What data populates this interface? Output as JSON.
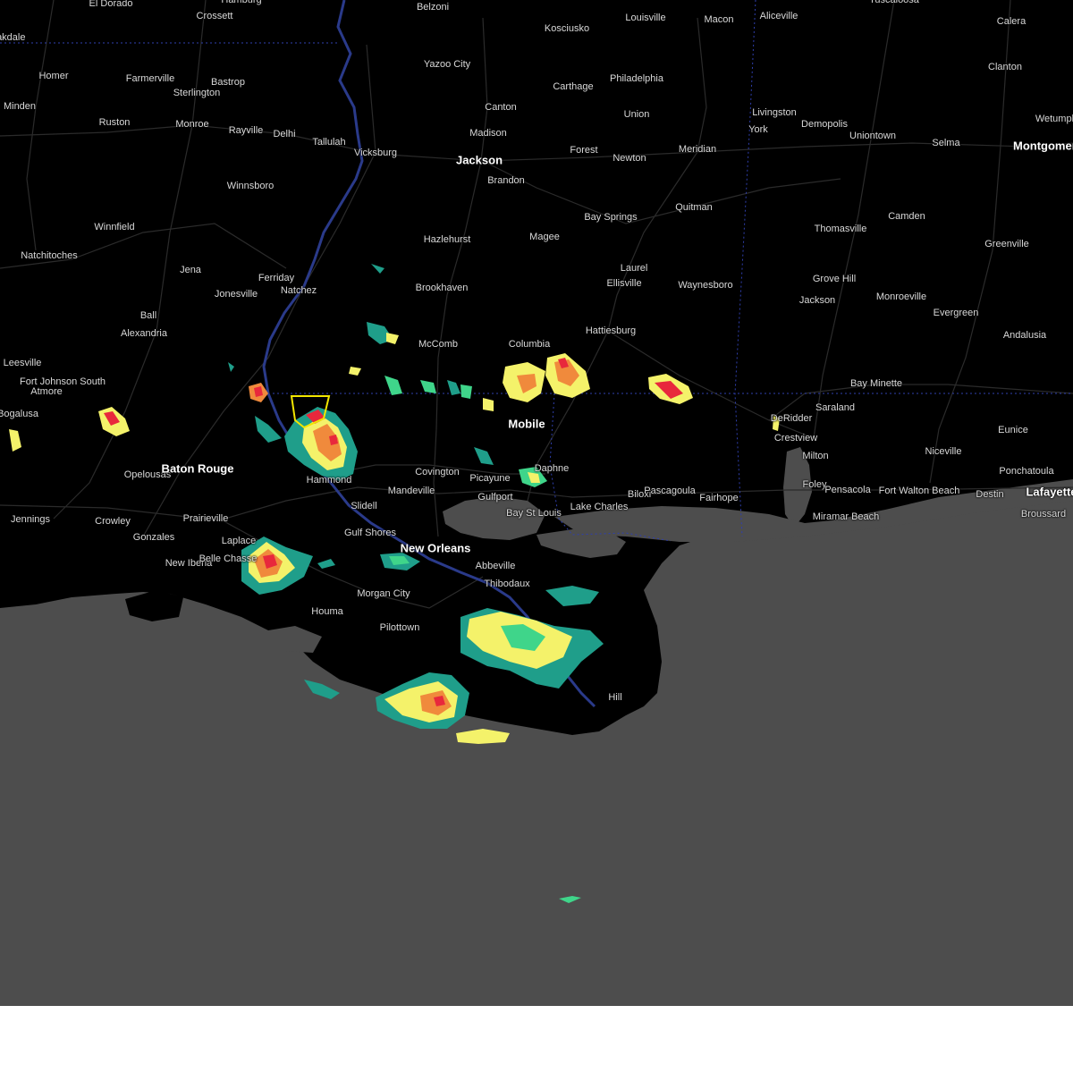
{
  "map": {
    "colors": {
      "land": "#000000",
      "water": "#4d4d4d",
      "roads": "#2b2b2b",
      "river": "#2a3a8a",
      "state_border": "#2f3fae",
      "warning_polygon": "#f2e600",
      "radar_light": "#1f9e8a",
      "radar_mid": "#3fd58a",
      "radar_yellow": "#f4f26a",
      "radar_orange": "#f08a3c",
      "radar_red": "#e8283c"
    },
    "cities": [
      {
        "name": "El Dorado",
        "big": false
      },
      {
        "name": "Crossett",
        "big": false
      },
      {
        "name": "Hamburg",
        "big": false
      },
      {
        "name": "Belzoni",
        "big": false
      },
      {
        "name": "Kosciusko",
        "big": false
      },
      {
        "name": "Louisville",
        "big": false
      },
      {
        "name": "Macon",
        "big": false
      },
      {
        "name": "Aliceville",
        "big": false
      },
      {
        "name": "Tuscaloosa",
        "big": false
      },
      {
        "name": "Calera",
        "big": false
      },
      {
        "name": "Homer",
        "big": false
      },
      {
        "name": "Farmerville",
        "big": false
      },
      {
        "name": "Bastrop",
        "big": false
      },
      {
        "name": "Sterlington",
        "big": false
      },
      {
        "name": "Yazoo City",
        "big": false
      },
      {
        "name": "Carthage",
        "big": false
      },
      {
        "name": "Philadelphia",
        "big": false
      },
      {
        "name": "Clanton",
        "big": false
      },
      {
        "name": "Minden",
        "big": false
      },
      {
        "name": "Ruston",
        "big": false
      },
      {
        "name": "Monroe",
        "big": false
      },
      {
        "name": "Rayville",
        "big": false
      },
      {
        "name": "Delhi",
        "big": false
      },
      {
        "name": "Tallulah",
        "big": false
      },
      {
        "name": "Canton",
        "big": false
      },
      {
        "name": "Madison",
        "big": false
      },
      {
        "name": "Union",
        "big": false
      },
      {
        "name": "Livingston",
        "big": false
      },
      {
        "name": "York",
        "big": false
      },
      {
        "name": "Demopolis",
        "big": false
      },
      {
        "name": "Uniontown",
        "big": false
      },
      {
        "name": "Selma",
        "big": false
      },
      {
        "name": "Montgomery",
        "big": true
      },
      {
        "name": "Wetumpka",
        "big": false
      },
      {
        "name": "Vicksburg",
        "big": false
      },
      {
        "name": "Jackson",
        "big": true
      },
      {
        "name": "Brandon",
        "big": false
      },
      {
        "name": "Forest",
        "big": false
      },
      {
        "name": "Newton",
        "big": false
      },
      {
        "name": "Meridian",
        "big": false
      },
      {
        "name": "Winnsboro",
        "big": false
      },
      {
        "name": "Bay Springs",
        "big": false
      },
      {
        "name": "Quitman",
        "big": false
      },
      {
        "name": "Thomasville",
        "big": false
      },
      {
        "name": "Camden",
        "big": false
      },
      {
        "name": "Natchitoches",
        "big": false
      },
      {
        "name": "Winnfield",
        "big": false
      },
      {
        "name": "Hazlehurst",
        "big": false
      },
      {
        "name": "Magee",
        "big": false
      },
      {
        "name": "Greenville",
        "big": false
      },
      {
        "name": "Jena",
        "big": false
      },
      {
        "name": "Ferriday",
        "big": false
      },
      {
        "name": "Jonesville",
        "big": false
      },
      {
        "name": "Natchez",
        "big": false
      },
      {
        "name": "Brookhaven",
        "big": false
      },
      {
        "name": "Laurel",
        "big": false
      },
      {
        "name": "Ellisville",
        "big": false
      },
      {
        "name": "Waynesboro",
        "big": false
      },
      {
        "name": "Grove Hill",
        "big": false
      },
      {
        "name": "Monroeville",
        "big": false
      },
      {
        "name": "Jackson",
        "big": false
      },
      {
        "name": "Evergreen",
        "big": false
      },
      {
        "name": "Ball",
        "big": false
      },
      {
        "name": "Alexandria",
        "big": false
      },
      {
        "name": "McComb",
        "big": false
      },
      {
        "name": "Columbia",
        "big": false
      },
      {
        "name": "Hattiesburg",
        "big": false
      },
      {
        "name": "Andalusia",
        "big": false
      },
      {
        "name": "Leesville",
        "big": false
      },
      {
        "name": "Fort Johnson South",
        "big": false
      },
      {
        "name": "Atmore",
        "big": false
      },
      {
        "name": "Bay Minette",
        "big": false
      },
      {
        "name": "Saraland",
        "big": false
      },
      {
        "name": "DeRidder",
        "big": false
      },
      {
        "name": "Bogalusa",
        "big": false
      },
      {
        "name": "Mobile",
        "big": true
      },
      {
        "name": "Crestview",
        "big": false
      },
      {
        "name": "Eunice",
        "big": false
      },
      {
        "name": "Opelousas",
        "big": false
      },
      {
        "name": "Baton Rouge",
        "big": true
      },
      {
        "name": "Hammond",
        "big": false
      },
      {
        "name": "Covington",
        "big": false
      },
      {
        "name": "Picayune",
        "big": false
      },
      {
        "name": "Daphne",
        "big": false
      },
      {
        "name": "Milton",
        "big": false
      },
      {
        "name": "Niceville",
        "big": false
      },
      {
        "name": "Ponchatoula",
        "big": false
      },
      {
        "name": "Mandeville",
        "big": false
      },
      {
        "name": "Gulfport",
        "big": false
      },
      {
        "name": "Biloxi",
        "big": false
      },
      {
        "name": "Pascagoula",
        "big": false
      },
      {
        "name": "Fairhope",
        "big": false
      },
      {
        "name": "Foley",
        "big": false
      },
      {
        "name": "Pensacola",
        "big": false
      },
      {
        "name": "Fort Walton Beach",
        "big": false
      },
      {
        "name": "Destin",
        "big": false
      },
      {
        "name": "Lafayette",
        "big": true
      },
      {
        "name": "Prairieville",
        "big": false
      },
      {
        "name": "Slidell",
        "big": false
      },
      {
        "name": "Bay St Louis",
        "big": false
      },
      {
        "name": "Lake Charles",
        "big": false
      },
      {
        "name": "Jennings",
        "big": false
      },
      {
        "name": "Crowley",
        "big": false
      },
      {
        "name": "Gonzales",
        "big": false
      },
      {
        "name": "Gulf Shores",
        "big": false
      },
      {
        "name": "Miramar Beach",
        "big": false
      },
      {
        "name": "Broussard",
        "big": false
      },
      {
        "name": "Laplace",
        "big": false
      },
      {
        "name": "New Orleans",
        "big": true
      },
      {
        "name": "Abbeville",
        "big": false
      },
      {
        "name": "New Iberia",
        "big": false
      },
      {
        "name": "Belle Chasse",
        "big": false
      },
      {
        "name": "Thibodaux",
        "big": false
      },
      {
        "name": "Morgan City",
        "big": false
      },
      {
        "name": "Houma",
        "big": false
      },
      {
        "name": "Pilottown",
        "big": false
      },
      {
        "name": "Hill",
        "big": false
      },
      {
        "name": "Oakdale",
        "big": false
      },
      {
        "name": "Natchitoches",
        "big": false
      }
    ]
  }
}
